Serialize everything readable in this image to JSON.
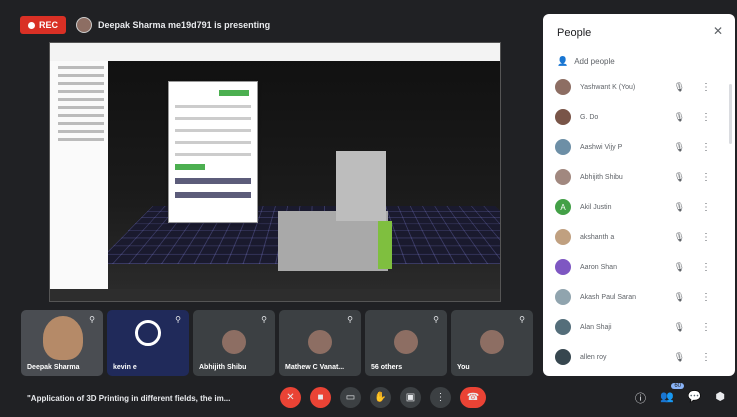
{
  "topbar": {
    "rec_label": "REC",
    "presenting_text": "Deepak Sharma me19d791 is presenting"
  },
  "people_panel": {
    "title": "People",
    "close_icon": "close-icon",
    "add_people_label": "Add people",
    "participants": [
      {
        "name": "Yashwant K (You)",
        "color": "#8d6e63",
        "initial": ""
      },
      {
        "name": "G. Do",
        "color": "#795548",
        "initial": ""
      },
      {
        "name": "Aashwi Vijy P",
        "color": "#6d8fa6",
        "initial": ""
      },
      {
        "name": "Abhijith Shibu",
        "color": "#a1887f",
        "initial": ""
      },
      {
        "name": "Akil Justin",
        "color": "#43a047",
        "initial": "A"
      },
      {
        "name": "akshanth a",
        "color": "#c0a080",
        "initial": ""
      },
      {
        "name": "Aaron Shan",
        "color": "#7e57c2",
        "initial": ""
      },
      {
        "name": "Akash Paul Saran",
        "color": "#90a4ae",
        "initial": ""
      },
      {
        "name": "Alan Shaji",
        "color": "#546e7a",
        "initial": ""
      },
      {
        "name": "allen roy",
        "color": "#37474f",
        "initial": ""
      }
    ]
  },
  "tiles": [
    {
      "label": "Deepak Sharma",
      "kind": "cam"
    },
    {
      "label": "kevin e",
      "kind": "obs"
    },
    {
      "label": "Abhijith Shibu",
      "kind": "avatar"
    },
    {
      "label": "Mathew C Vanat...",
      "kind": "avatar"
    },
    {
      "label": "56 others",
      "kind": "avatar"
    },
    {
      "label": "You",
      "kind": "avatar"
    }
  ],
  "bottombar": {
    "caption": "\"Application of 3D Printing in different fields, the im...",
    "participant_badge": "60"
  },
  "colors": {
    "accent": "#ea4335",
    "panel_bg": "#ffffff",
    "bg": "#202124"
  }
}
